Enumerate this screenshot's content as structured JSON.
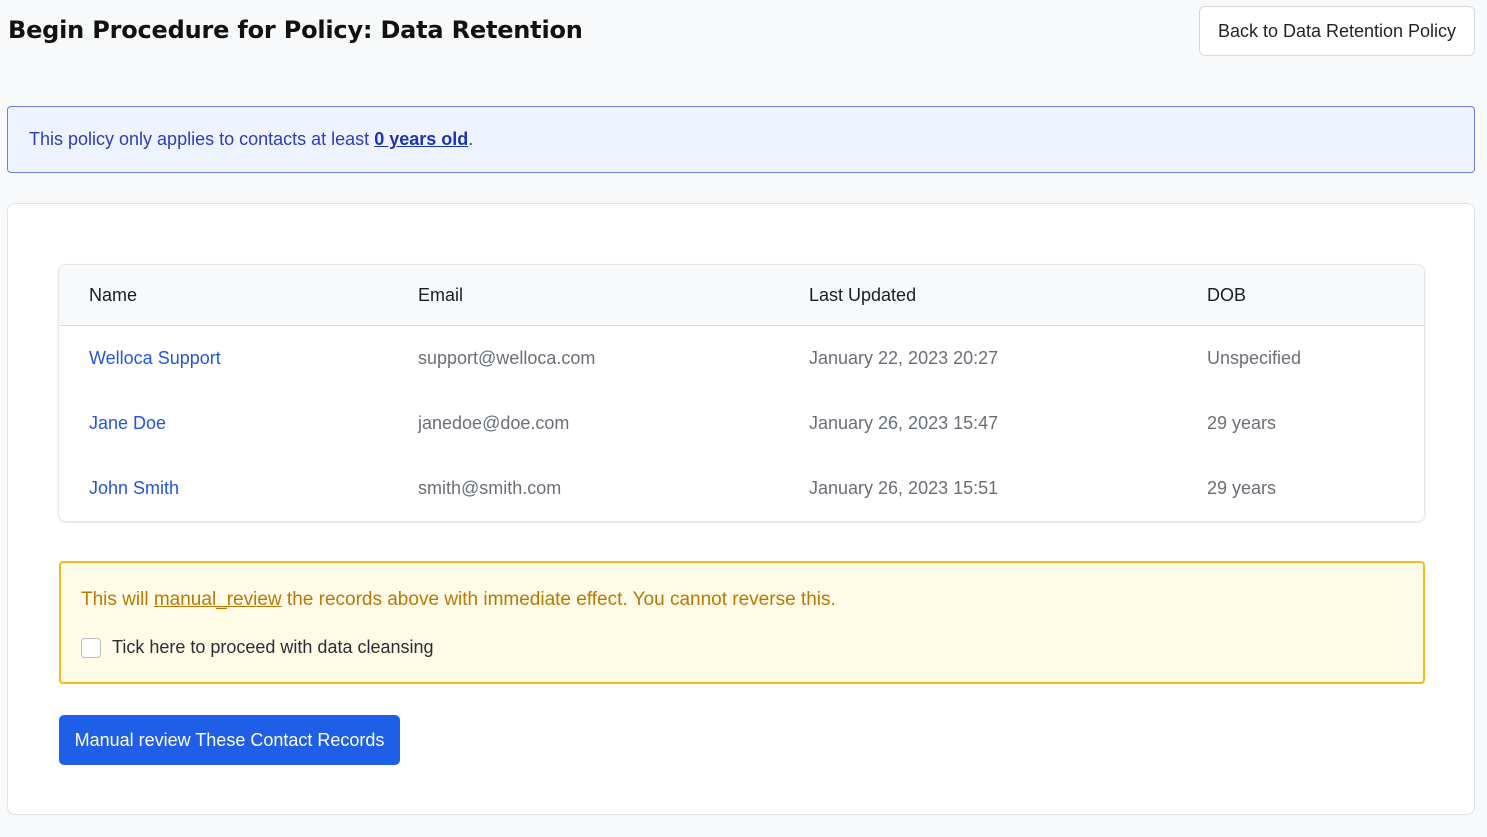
{
  "header": {
    "title": "Begin Procedure for Policy: Data Retention",
    "back_button_label": "Back to Data Retention Policy"
  },
  "info_banner": {
    "text_prefix": "This policy only applies to contacts at least ",
    "age_link": "0 years old",
    "text_suffix": "."
  },
  "table": {
    "columns": [
      "Name",
      "Email",
      "Last Updated",
      "DOB"
    ],
    "rows": [
      {
        "name": "Welloca Support",
        "email": "support@welloca.com",
        "last_updated": "January 22, 2023 20:27",
        "dob": "Unspecified"
      },
      {
        "name": "Jane Doe",
        "email": "janedoe@doe.com",
        "last_updated": "January 26, 2023 15:47",
        "dob": "29 years"
      },
      {
        "name": "John Smith",
        "email": "smith@smith.com",
        "last_updated": "January 26, 2023 15:51",
        "dob": "29 years"
      }
    ]
  },
  "warning": {
    "text_prefix": "This will ",
    "action_link": "manual_review",
    "text_suffix": " the records above with immediate effect. You cannot reverse this.",
    "checkbox_label": "Tick here to proceed with data cleansing",
    "checkbox_checked": false
  },
  "submit_button_label": "Manual review These Contact Records",
  "colors": {
    "primary": "#1f5fe8",
    "link": "#2456d9",
    "warning_border": "#efbd1c",
    "warning_bg": "#fffbe6",
    "info_bg": "#eef4ff",
    "info_border": "#6f7fd6"
  }
}
